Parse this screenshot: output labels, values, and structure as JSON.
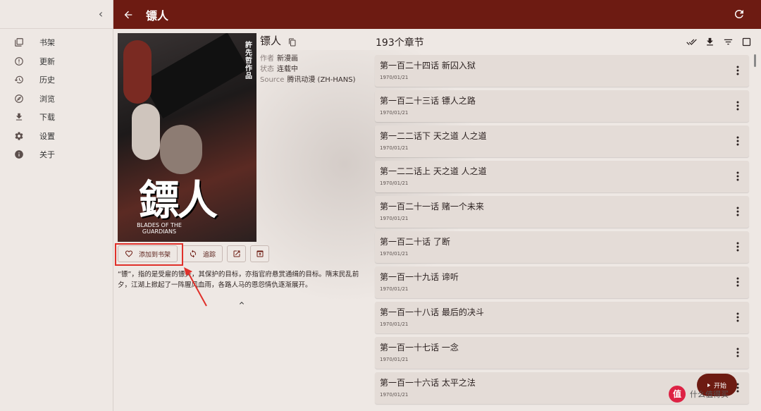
{
  "sidebar": {
    "collapse_icon": "chevron-left-icon",
    "items": [
      {
        "label": "书架",
        "icon": "library-icon"
      },
      {
        "label": "更新",
        "icon": "alert-circle-icon"
      },
      {
        "label": "历史",
        "icon": "history-icon"
      },
      {
        "label": "浏览",
        "icon": "compass-icon"
      },
      {
        "label": "下载",
        "icon": "download-icon"
      },
      {
        "label": "设置",
        "icon": "gear-icon"
      },
      {
        "label": "关于",
        "icon": "info-icon"
      }
    ]
  },
  "topbar": {
    "title": "镖人",
    "bg_color": "#6d1b12"
  },
  "manga": {
    "title": "镖人",
    "cover_title": "鏢人",
    "cover_subtitle": "BLADES OF THE GUARDIANS",
    "cover_author": "許先哲作品",
    "author_label": "作者",
    "author": "新漫画",
    "status_label": "状态",
    "status": "连载中",
    "source_label": "Source",
    "source": "腾讯动漫 (ZH-HANS)",
    "description": "“镖”，指的是受雇的镖夫，其保护的目标，亦指官府悬赏通缉的目标。隋末民乱前夕，江湖上掀起了一阵腥风血雨，各路人马的恩怨情仇逐渐展开。"
  },
  "actions": {
    "add_library": "添加到书架",
    "tracking": "追踪"
  },
  "chapters": {
    "count": "193个章节",
    "items": [
      {
        "title": "第一百二十四话 新囚入狱",
        "date": "1970/01/21"
      },
      {
        "title": "第一百二十三话 镖人之路",
        "date": "1970/01/21"
      },
      {
        "title": "第一二二话下 天之道 人之道",
        "date": "1970/01/21"
      },
      {
        "title": "第一二二话上 天之道 人之道",
        "date": "1970/01/21"
      },
      {
        "title": "第一百二十一话 赌一个未来",
        "date": "1970/01/21"
      },
      {
        "title": "第一百二十话 了断",
        "date": "1970/01/21"
      },
      {
        "title": "第一百一十九话 谛听",
        "date": "1970/01/21"
      },
      {
        "title": "第一百一十八话 最后的决斗",
        "date": "1970/01/21"
      },
      {
        "title": "第一百一十七话 一念",
        "date": "1970/01/21"
      },
      {
        "title": "第一百一十六话 太平之法",
        "date": "1970/01/21"
      }
    ]
  },
  "fab": {
    "label": "开始"
  },
  "watermark": {
    "text": "什么值得买",
    "logo": "值"
  },
  "colors": {
    "accent": "#6d1b12",
    "highlight": "#e0302a"
  }
}
